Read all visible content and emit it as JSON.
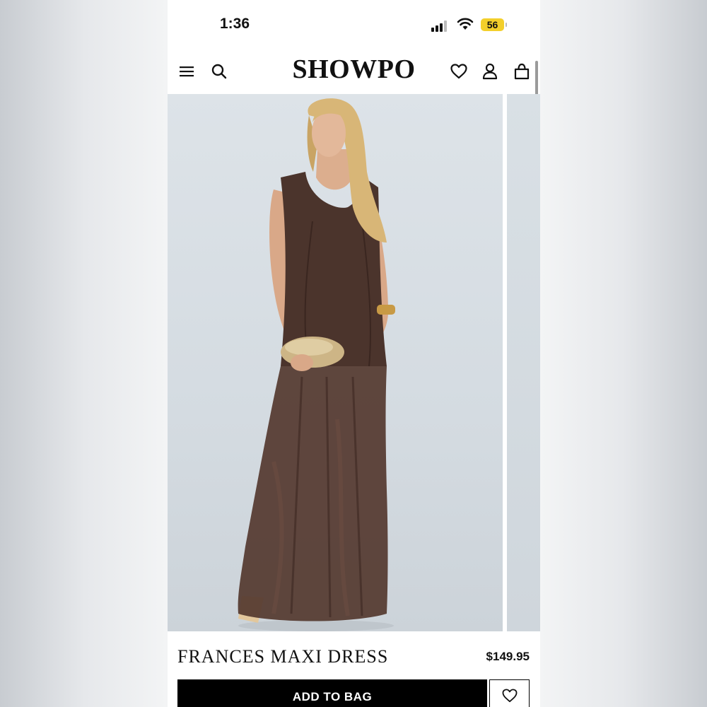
{
  "status_bar": {
    "time": "1:36",
    "battery": "56"
  },
  "header": {
    "logo": "SHOWPO",
    "icons": [
      "menu-icon",
      "search-icon",
      "heart-icon",
      "account-icon",
      "bag-icon"
    ]
  },
  "product": {
    "name": "FRANCES MAXI DRESS",
    "price": "$149.95",
    "add_to_bag_label": "ADD TO BAG"
  },
  "colors": {
    "dress": "#4b342c",
    "background": "#dde3e8",
    "button": "#000000"
  }
}
